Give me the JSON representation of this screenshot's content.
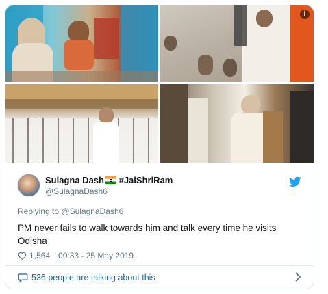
{
  "tweet": {
    "photos": [
      {
        "label": "man-praying-photo"
      },
      {
        "label": "monkeys-photo"
      },
      {
        "label": "students-photo"
      },
      {
        "label": "pm-meeting-photo"
      }
    ],
    "info_badge": "i",
    "author": {
      "name": "Sulagna Dash",
      "suffix": "#JaiShriRam",
      "handle": "@SulagnaDash6"
    },
    "replying_prefix": "Replying to",
    "replying_to": "@SulagnaDash6",
    "text": "PM never fails to walk towards him and talk every time he visits Odisha",
    "likes": "1,564",
    "timestamp": "00:33 - 25 May 2019",
    "talking": "536 people are talking about this",
    "colors": {
      "twitter_blue": "#1da1f2",
      "link_blue": "#1b6aa5",
      "secondary_text": "#657786",
      "border": "#e1e8ed"
    },
    "icons": [
      "twitter-bird-icon",
      "heart-icon",
      "speech-bubble-icon",
      "chevron-right-icon",
      "info-icon"
    ]
  }
}
